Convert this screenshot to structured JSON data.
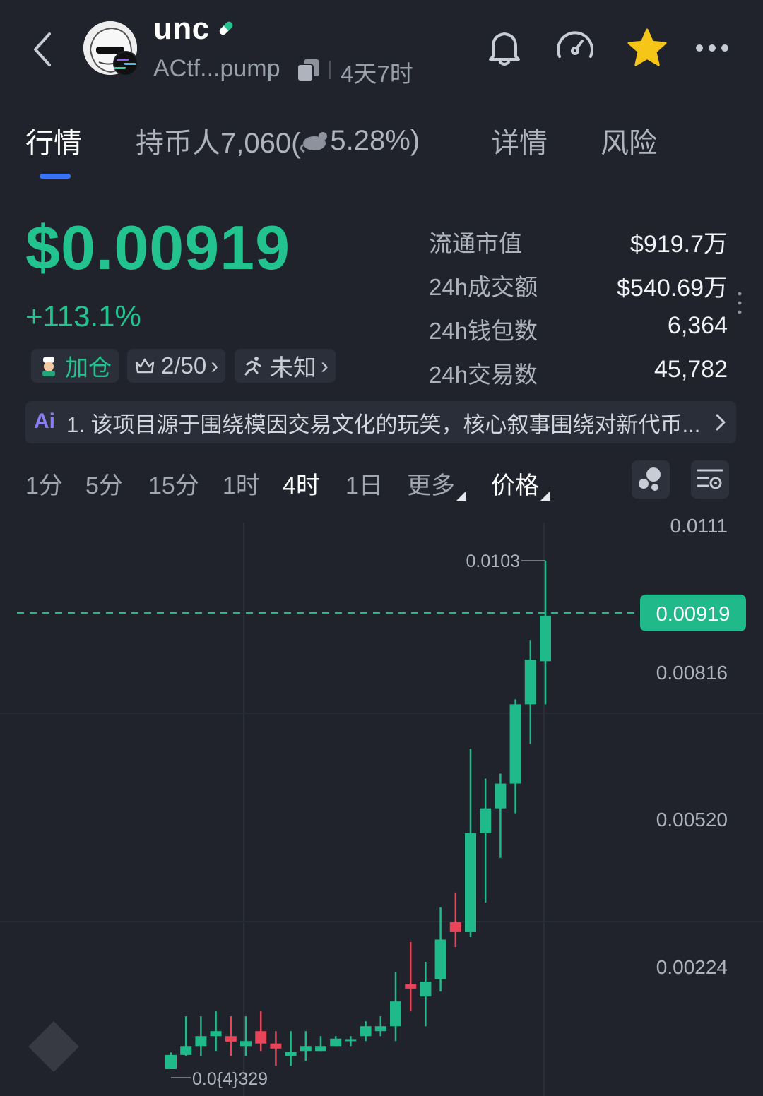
{
  "header": {
    "token_name": "unc",
    "address": "ACtf...pump",
    "age": "4天7时",
    "icons": [
      "back-arrow-icon",
      "avatar-icon",
      "solana-badge-icon",
      "pill-icon",
      "copy-icon",
      "bell-icon",
      "speedometer-icon",
      "star-icon",
      "more-icon"
    ],
    "star_color": "#f5c518"
  },
  "tabs": [
    {
      "label": "行情",
      "active": true
    },
    {
      "label": "持币人7,060(",
      "emoji_icon": "rat-icon",
      "suffix": "5.28%)"
    },
    {
      "label": "详情"
    },
    {
      "label": "风险"
    }
  ],
  "price": {
    "value": "$0.00919",
    "change": "+113.1%",
    "color": "#22c38e"
  },
  "chips": [
    {
      "icon": "chef-avatar-icon",
      "label": "加仓",
      "color": "#22c38e"
    },
    {
      "icon": "top-crown-icon",
      "label": "2/50",
      "arrow": "›"
    },
    {
      "icon": "runner-icon",
      "label": "未知",
      "arrow": "›"
    }
  ],
  "stats": [
    {
      "label": "流通市值",
      "value": "$919.7万"
    },
    {
      "label": "24h成交额",
      "value": "$540.69万"
    },
    {
      "label": "24h钱包数",
      "value": "6,364"
    },
    {
      "label": "24h交易数",
      "value": "45,782"
    }
  ],
  "ai_banner": {
    "logo": "Ai",
    "text": "1. 该项目源于围绕模因交易文化的玩笑，核心叙事围绕对新代币..."
  },
  "intervals": [
    "1分",
    "5分",
    "15分",
    "1时",
    "4时",
    "1日"
  ],
  "interval_active": "4时",
  "more_label": "更多",
  "price_label": "价格",
  "tools": [
    "bubble-icon",
    "settings-filter-icon"
  ],
  "chart_data": {
    "type": "candlestick",
    "y_ticks": [
      "0.0111",
      "0.00816",
      "0.00520",
      "0.00224"
    ],
    "current_price": "0.00919",
    "high_label": "0.0103",
    "low_label": "0.0{4}329",
    "up_color": "#1fb98a",
    "down_color": "#e8445a",
    "candles": [
      {
        "o": 3.29e-05,
        "h": 0.00037,
        "l": 3.29e-05,
        "c": 0.00032
      },
      {
        "o": 0.00032,
        "h": 0.0011,
        "l": 0.0003,
        "c": 0.0005
      },
      {
        "o": 0.0005,
        "h": 0.0011,
        "l": 0.0003,
        "c": 0.0007
      },
      {
        "o": 0.0007,
        "h": 0.0012,
        "l": 0.0004,
        "c": 0.0008
      },
      {
        "o": 0.0007,
        "h": 0.0011,
        "l": 0.0003,
        "c": 0.00059
      },
      {
        "o": 0.0005,
        "h": 0.0011,
        "l": 0.0003,
        "c": 0.0006
      },
      {
        "o": 0.0008,
        "h": 0.0012,
        "l": 0.0004,
        "c": 0.00055
      },
      {
        "o": 0.00055,
        "h": 0.0008,
        "l": 0.0001,
        "c": 0.00045
      },
      {
        "o": 0.0003,
        "h": 0.0008,
        "l": 0.0001,
        "c": 0.00038
      },
      {
        "o": 0.0004,
        "h": 0.0008,
        "l": 0.0002,
        "c": 0.0005
      },
      {
        "o": 0.0004,
        "h": 0.0007,
        "l": 0.0004,
        "c": 0.0005
      },
      {
        "o": 0.0005,
        "h": 0.0007,
        "l": 0.0005,
        "c": 0.00065
      },
      {
        "o": 0.0006,
        "h": 0.0007,
        "l": 0.0005,
        "c": 0.00064
      },
      {
        "o": 0.0007,
        "h": 0.001,
        "l": 0.0006,
        "c": 0.0009
      },
      {
        "o": 0.0008,
        "h": 0.0011,
        "l": 0.0007,
        "c": 0.0009
      },
      {
        "o": 0.0009,
        "h": 0.002,
        "l": 0.0006,
        "c": 0.0014
      },
      {
        "o": 0.00175,
        "h": 0.0026,
        "l": 0.0012,
        "c": 0.00166
      },
      {
        "o": 0.0015,
        "h": 0.0022,
        "l": 0.0009,
        "c": 0.0018
      },
      {
        "o": 0.00185,
        "h": 0.0033,
        "l": 0.0016,
        "c": 0.00265
      },
      {
        "o": 0.003,
        "h": 0.0036,
        "l": 0.0025,
        "c": 0.0028
      },
      {
        "o": 0.0028,
        "h": 0.0065,
        "l": 0.0027,
        "c": 0.0048
      },
      {
        "o": 0.0048,
        "h": 0.0059,
        "l": 0.0034,
        "c": 0.0053
      },
      {
        "o": 0.0053,
        "h": 0.006,
        "l": 0.0043,
        "c": 0.0058
      },
      {
        "o": 0.0058,
        "h": 0.0075,
        "l": 0.0052,
        "c": 0.0074
      },
      {
        "o": 0.0074,
        "h": 0.0087,
        "l": 0.0066,
        "c": 0.0083
      },
      {
        "o": 0.0083,
        "h": 0.0093,
        "l": 0.007,
        "c": 0.00919
      }
    ],
    "final_candle": {
      "o": 0.00827,
      "h": 0.0103,
      "l": 0.0074,
      "c": 0.00919
    },
    "grid": true,
    "y_axis": "right"
  }
}
